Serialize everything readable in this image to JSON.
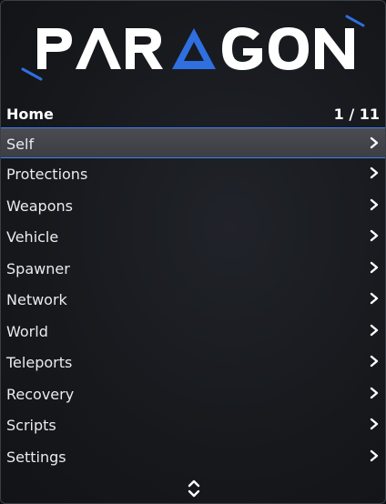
{
  "brand": {
    "logo_text": "PARAGON",
    "accent_color": "#2f6fe0"
  },
  "header": {
    "title": "Home",
    "page_indicator": "1 / 11"
  },
  "menu": {
    "items": [
      {
        "label": "Self",
        "selected": true,
        "icon": "chevron-right-icon"
      },
      {
        "label": "Protections",
        "icon": "chevron-right-icon"
      },
      {
        "label": "Weapons",
        "icon": "chevron-right-icon"
      },
      {
        "label": "Vehicle",
        "icon": "chevron-right-icon"
      },
      {
        "label": "Spawner",
        "icon": "chevron-right-icon"
      },
      {
        "label": "Network",
        "icon": "chevron-right-icon"
      },
      {
        "label": "World",
        "icon": "chevron-right-icon"
      },
      {
        "label": "Teleports",
        "icon": "chevron-right-icon"
      },
      {
        "label": "Recovery",
        "icon": "chevron-right-icon"
      },
      {
        "label": "Scripts",
        "icon": "chevron-right-icon"
      },
      {
        "label": "Settings",
        "icon": "chevron-right-icon"
      }
    ]
  },
  "footer": {
    "scroll_icon": "up-down-chevron-icon"
  },
  "colors": {
    "selection_border": "#3b82f6",
    "selection_bg": "#45474c",
    "text": "#e9ebee"
  }
}
